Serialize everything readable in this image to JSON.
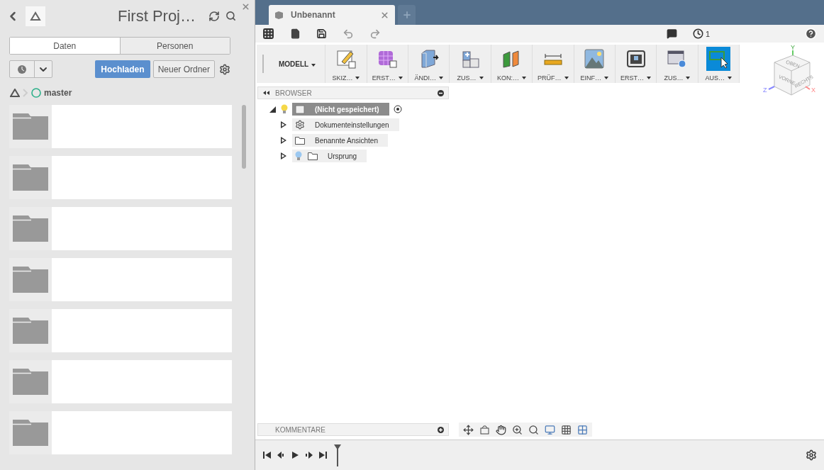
{
  "left_panel": {
    "title": "First Proj…",
    "tabs": [
      {
        "label": "Daten",
        "selected": true
      },
      {
        "label": "Personen",
        "selected": false
      }
    ],
    "upload_button": "Hochladen",
    "new_folder_button": "Neuer Ordner",
    "breadcrumb": "master",
    "items": [
      {
        "kind": "folder"
      },
      {
        "kind": "folder"
      },
      {
        "kind": "folder"
      },
      {
        "kind": "folder"
      },
      {
        "kind": "folder"
      },
      {
        "kind": "folder"
      },
      {
        "kind": "folder"
      }
    ]
  },
  "document_tabs": [
    {
      "label": "Unbenannt",
      "selected": true
    }
  ],
  "jobs_count": "1",
  "ribbon": {
    "mode": "MODELL",
    "groups": [
      {
        "label": "SKIZ…",
        "kind": "sketch"
      },
      {
        "label": "ERST…",
        "kind": "create"
      },
      {
        "label": "ÄNDI…",
        "kind": "modify"
      },
      {
        "label": "ZUS…",
        "kind": "assemble"
      },
      {
        "label": "KON:…",
        "kind": "construct"
      },
      {
        "label": "PRÜF…",
        "kind": "inspect"
      },
      {
        "label": "EINF…",
        "kind": "insert"
      },
      {
        "label": "ERST…",
        "kind": "make"
      },
      {
        "label": "ZUS…",
        "kind": "addins"
      },
      {
        "label": "AUS…",
        "kind": "select",
        "selected": true
      }
    ]
  },
  "viewcube": {
    "faces": [
      "OBEN",
      "VORNE",
      "RECHTS"
    ],
    "axes": [
      "Y",
      "Z",
      "X"
    ]
  },
  "browser": {
    "title": "BROWSER",
    "root": {
      "label": "(Nicht gespeichert)",
      "expanded": true,
      "children": [
        {
          "label": "Dokumenteinstellungen",
          "kind": "settings",
          "expanded": false
        },
        {
          "label": "Benannte Ansichten",
          "kind": "folder",
          "expanded": false
        },
        {
          "label": "Ursprung",
          "kind": "origin",
          "expanded": false
        }
      ]
    }
  },
  "comments": {
    "title": "KOMMENTARE"
  }
}
